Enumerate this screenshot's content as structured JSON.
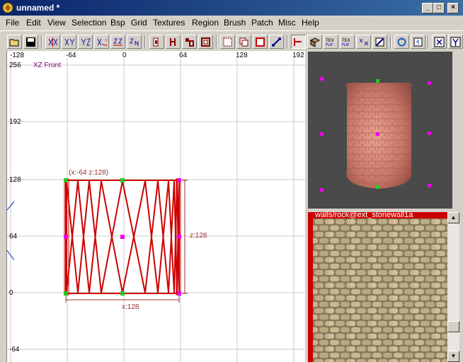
{
  "window": {
    "title": "unnamed *",
    "min_label": "_",
    "max_label": "□",
    "close_label": "×"
  },
  "menu": [
    "File",
    "Edit",
    "View",
    "Selection",
    "Bsp",
    "Grid",
    "Textures",
    "Region",
    "Brush",
    "Patch",
    "Misc",
    "Help"
  ],
  "toolbar": {
    "buttons": [
      "open-icon",
      "save-icon",
      "flip-x-icon",
      "flip-y-icon",
      "flip-z-icon",
      "rotate-x-icon",
      "rotate-y-icon",
      "rotate-z-icon",
      "csg-subtract-icon",
      "csg-merge-icon",
      "hollow-icon",
      "make-room-icon",
      "clipper-icon",
      "change-view-icon",
      "texture-lock-icon",
      "camera-preview-icon",
      "cube-clip-icon",
      "vertex-edit-icon",
      "select-icon",
      "entity-icon",
      "texture-fit-icon",
      "texture-flip-icon",
      "scale-icon",
      "patch-icon",
      "refresh-icon",
      "window-icon",
      "x-icon",
      "y-icon"
    ]
  },
  "viewport": {
    "label": "XZ Front",
    "x_ticks": [
      "-128",
      "-64",
      "0",
      "64",
      "128",
      "192"
    ],
    "y_ticks": [
      "256",
      "192",
      "128",
      "64",
      "0",
      "-64"
    ],
    "coord_readout": "(x:-64  z:128)",
    "width_label": "x:128",
    "height_label": "z:128"
  },
  "texture": {
    "name": "walls/rock@ext_stonewall1a"
  },
  "colors": {
    "brush": "#cc0000",
    "grid": "#c8c8c8",
    "handle_green": "#22cc22",
    "handle_magenta": "#ee00ee"
  }
}
